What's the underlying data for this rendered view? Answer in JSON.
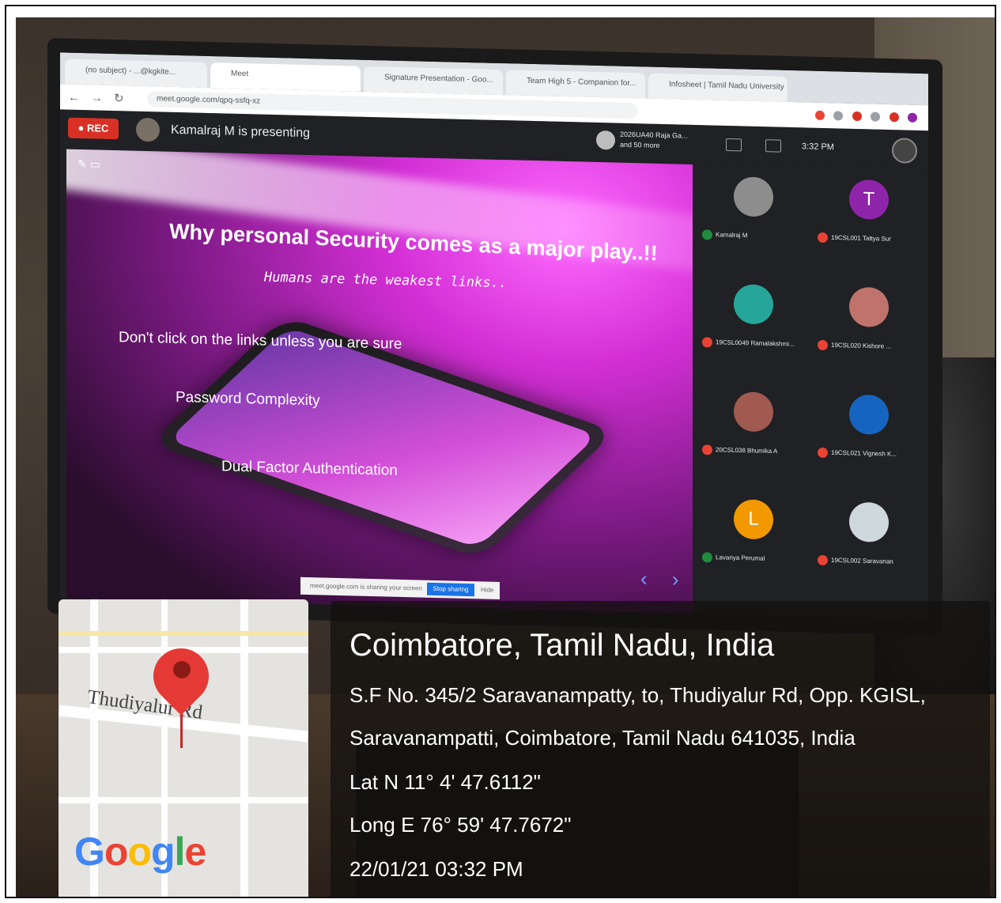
{
  "browser": {
    "tabs": [
      {
        "label": "(no subject) - ...@kgkite...",
        "color": "#d93025"
      },
      {
        "label": "Meet",
        "color": "#00897b"
      },
      {
        "label": "Signature Presentation - Goo...",
        "color": "#fbbc04"
      },
      {
        "label": "Team High 5 - Companion for...",
        "color": "#f29900"
      },
      {
        "label": "Infosheet | Tamil Nadu University",
        "color": "#1e8e3e"
      }
    ],
    "url": "meet.google.com/qpq-ssfq-xz"
  },
  "meet": {
    "rec_label": "REC",
    "presenting": "Kamalraj M is presenting",
    "others": [
      "2026UA40 Raja Ga...",
      "and 50 more"
    ],
    "time": "3:32 PM"
  },
  "slide": {
    "title": "Why personal Security comes as a major play..!!",
    "subtitle": "Humans are the weakest links..",
    "points": [
      "Don't click on the links unless you are sure",
      "Password Complexity",
      "Dual Factor Authentication"
    ],
    "present_bar": {
      "text": "meet.google.com is sharing your screen",
      "stop": "Stop sharing",
      "hide": "Hide"
    },
    "arrows": "‹ ›"
  },
  "participants": [
    {
      "name": "Kamalraj M",
      "initial": "",
      "color": "#8d8d8d",
      "mic": "on"
    },
    {
      "name": "19CSL001 Tattya Sur",
      "initial": "T",
      "color": "#8e24aa",
      "mic": "off"
    },
    {
      "name": "19CSL0049 Ramalakshmi...",
      "initial": "",
      "color": "#26a69a",
      "mic": "off"
    },
    {
      "name": "19CSL020 Kishore ...",
      "initial": "",
      "color": "#c0736c",
      "mic": "off"
    },
    {
      "name": "20CSL038 Bhumika A",
      "initial": "",
      "color": "#a15a50",
      "mic": "off"
    },
    {
      "name": "19CSL021 Vignesh K...",
      "initial": "",
      "color": "#1565c0",
      "mic": "off"
    },
    {
      "name": "Lavanya Perumal",
      "initial": "L",
      "color": "#f29900",
      "mic": "on"
    },
    {
      "name": "19CSL002 Saravanan",
      "initial": "",
      "color": "#cfd8dc",
      "mic": "off"
    }
  ],
  "map": {
    "street": "Thudiyalur Rd",
    "logo": [
      {
        "ch": "G",
        "color": "#4285f4"
      },
      {
        "ch": "o",
        "color": "#ea4335"
      },
      {
        "ch": "o",
        "color": "#fbbc05"
      },
      {
        "ch": "g",
        "color": "#4285f4"
      },
      {
        "ch": "l",
        "color": "#34a853"
      },
      {
        "ch": "e",
        "color": "#ea4335"
      }
    ]
  },
  "location": {
    "city": "Coimbatore, Tamil Nadu, India",
    "address1": "S.F No. 345/2 Saravanampatty, to, Thudiyalur Rd, Opp. KGISL,",
    "address2": "Saravanampatti, Coimbatore, Tamil Nadu 641035, India",
    "lat": "Lat N 11° 4' 47.6112\"",
    "long": "Long E 76° 59' 47.7672\"",
    "datetime": "22/01/21 03:32 PM"
  }
}
